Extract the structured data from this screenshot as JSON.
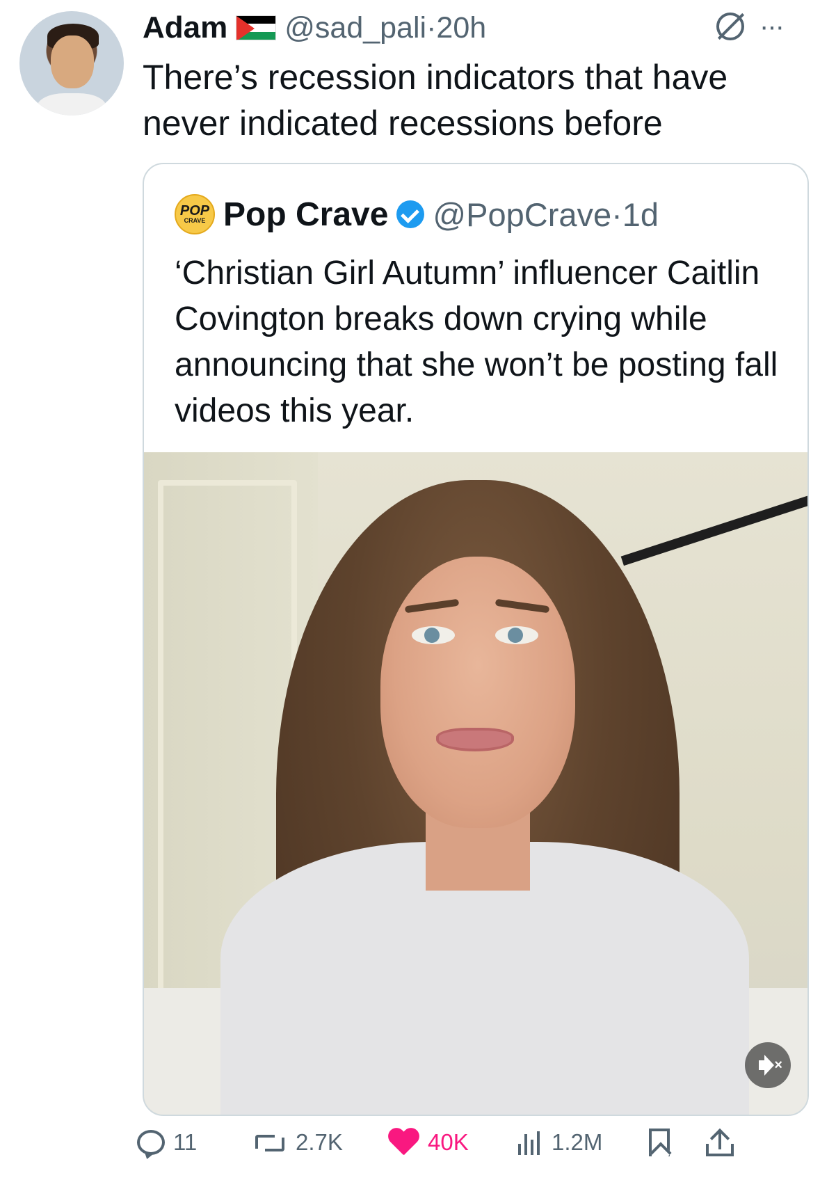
{
  "tweet": {
    "author_name": "Adam",
    "handle": "@sad_pali",
    "separator": "·",
    "time": "20h",
    "text": "There’s recession indicators that have never indicated recessions before"
  },
  "quoted_tweet": {
    "author_name": "Pop Crave",
    "logo_text_top": "POP",
    "logo_text_bottom": "CRAVE",
    "handle": "@PopCrave",
    "separator": "·",
    "time": "1d",
    "text": "‘Christian Girl Autumn’ influencer Caitlin Covington breaks down crying while announcing that she won’t be posting fall videos this year.",
    "media": {
      "type": "video",
      "muted": true
    }
  },
  "actions": {
    "replies": "11",
    "retweets": "2.7K",
    "likes": "40K",
    "views": "1.2M"
  },
  "colors": {
    "text_primary": "#0f1419",
    "text_secondary": "#536471",
    "like": "#f91880",
    "verified": "#1d9bf0",
    "border": "#cfd9de"
  },
  "icons": [
    "flag-icon",
    "grok-icon",
    "more-icon",
    "verified-icon",
    "mute-icon",
    "reply-icon",
    "retweet-icon",
    "heart-icon",
    "views-icon",
    "bookmark-icon",
    "share-icon"
  ]
}
